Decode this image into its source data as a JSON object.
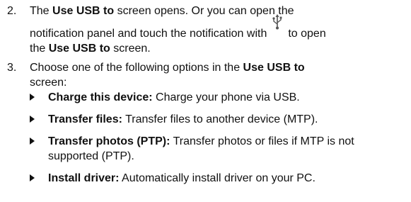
{
  "steps": [
    {
      "number": "2.",
      "line1_pre": "The ",
      "line1_bold": "Use USB to",
      "line1_post": " screen opens. Or you can open the",
      "line2_pre": "notification panel and touch the notification with",
      "line2_post": "to open",
      "line3_pre": "the ",
      "line3_bold": "Use USB to",
      "line3_post": " screen.",
      "icon": "usb-icon"
    },
    {
      "number": "3.",
      "line1_pre": "Choose one of the following options in the ",
      "line1_bold": "Use USB to",
      "line2": "screen:"
    }
  ],
  "options": [
    {
      "label": "Charge this device:",
      "text": " Charge your phone via USB."
    },
    {
      "label": "Transfer files:",
      "text": " Transfer files to another device (MTP)."
    },
    {
      "label": "Transfer photos (PTP):",
      "text": " Transfer photos or files if MTP is not supported (PTP)."
    },
    {
      "label": "Install driver:",
      "text": " Automatically install driver on your PC."
    }
  ],
  "colors": {
    "text": "#111111",
    "background": "#ffffff"
  }
}
